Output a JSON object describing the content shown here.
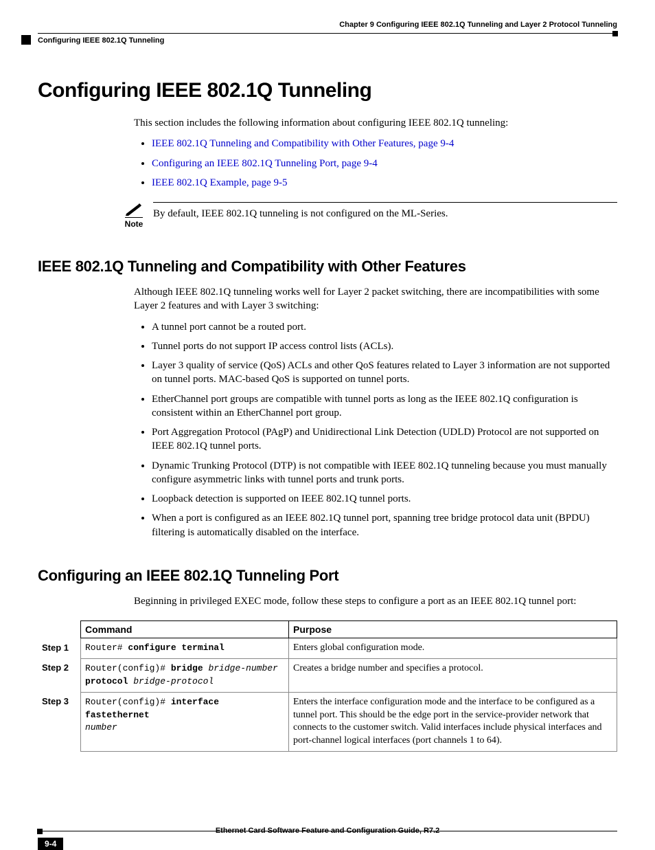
{
  "header": {
    "chapter_line": "Chapter 9    Configuring IEEE 802.1Q Tunneling and Layer 2 Protocol Tunneling",
    "breadcrumb": "Configuring IEEE 802.1Q Tunneling"
  },
  "h1": "Configuring IEEE 802.1Q Tunneling",
  "intro": "This section includes the following information about configuring IEEE 802.1Q tunneling:",
  "links": [
    "IEEE 802.1Q Tunneling and Compatibility with Other Features, page 9-4",
    "Configuring an IEEE 802.1Q Tunneling Port, page 9-4",
    "IEEE 802.1Q Example, page 9-5"
  ],
  "note": {
    "label": "Note",
    "text": "By default, IEEE 802.1Q tunneling is not configured on the ML-Series."
  },
  "sec1": {
    "title": "IEEE 802.1Q Tunneling and Compatibility with Other Features",
    "intro": "Although IEEE 802.1Q tunneling works well for Layer 2 packet switching, there are incompatibilities with some Layer 2 features and with Layer 3 switching:",
    "bullets": [
      "A tunnel port cannot be a routed port.",
      "Tunnel ports do not support IP access control lists (ACLs).",
      "Layer 3 quality of service (QoS) ACLs and other QoS features related to Layer 3 information are not supported on tunnel ports. MAC-based QoS is supported on tunnel ports.",
      "EtherChannel port groups are compatible with tunnel ports as long as the IEEE 802.1Q configuration is consistent within an EtherChannel port group.",
      "Port Aggregation Protocol (PAgP) and Unidirectional Link Detection (UDLD) Protocol are not supported on IEEE 802.1Q tunnel ports.",
      "Dynamic Trunking Protocol (DTP) is not compatible with IEEE 802.1Q tunneling because you must manually configure asymmetric links with tunnel ports and trunk ports.",
      "Loopback detection is supported on IEEE 802.1Q tunnel ports.",
      "When a port is configured as an IEEE 802.1Q tunnel port, spanning tree bridge protocol data unit (BPDU) filtering is automatically disabled on the interface."
    ]
  },
  "sec2": {
    "title": "Configuring an IEEE 802.1Q Tunneling Port",
    "intro": "Beginning in privileged EXEC mode, follow these steps to configure a port as an IEEE 802.1Q tunnel port:"
  },
  "table": {
    "head": {
      "command": "Command",
      "purpose": "Purpose"
    },
    "rows": [
      {
        "step": "Step 1",
        "cmd_prefix": "Router# ",
        "cmd_bold": "configure terminal",
        "cmd_italic": "",
        "cmd_line2_bold": "",
        "cmd_line2_italic": "",
        "purpose": "Enters global configuration mode."
      },
      {
        "step": "Step 2",
        "cmd_prefix": "Router(config)# ",
        "cmd_bold": "bridge",
        "cmd_italic": " bridge-number",
        "cmd_line2_bold": "protocol",
        "cmd_line2_italic": " bridge-protocol",
        "purpose": "Creates a bridge number and specifies a protocol."
      },
      {
        "step": "Step 3",
        "cmd_prefix": "Router(config)# ",
        "cmd_bold": "interface fastethernet",
        "cmd_italic": "",
        "cmd_line2_bold": "",
        "cmd_line2_italic": "number",
        "purpose": "Enters the interface configuration mode and the interface to be configured as a tunnel port. This should be the edge port in the service-provider network that connects to the customer switch. Valid interfaces include physical interfaces and port-channel logical interfaces (port channels 1 to 64)."
      }
    ]
  },
  "footer": {
    "title": "Ethernet Card Software Feature and Configuration Guide, R7.2",
    "page": "9-4"
  }
}
